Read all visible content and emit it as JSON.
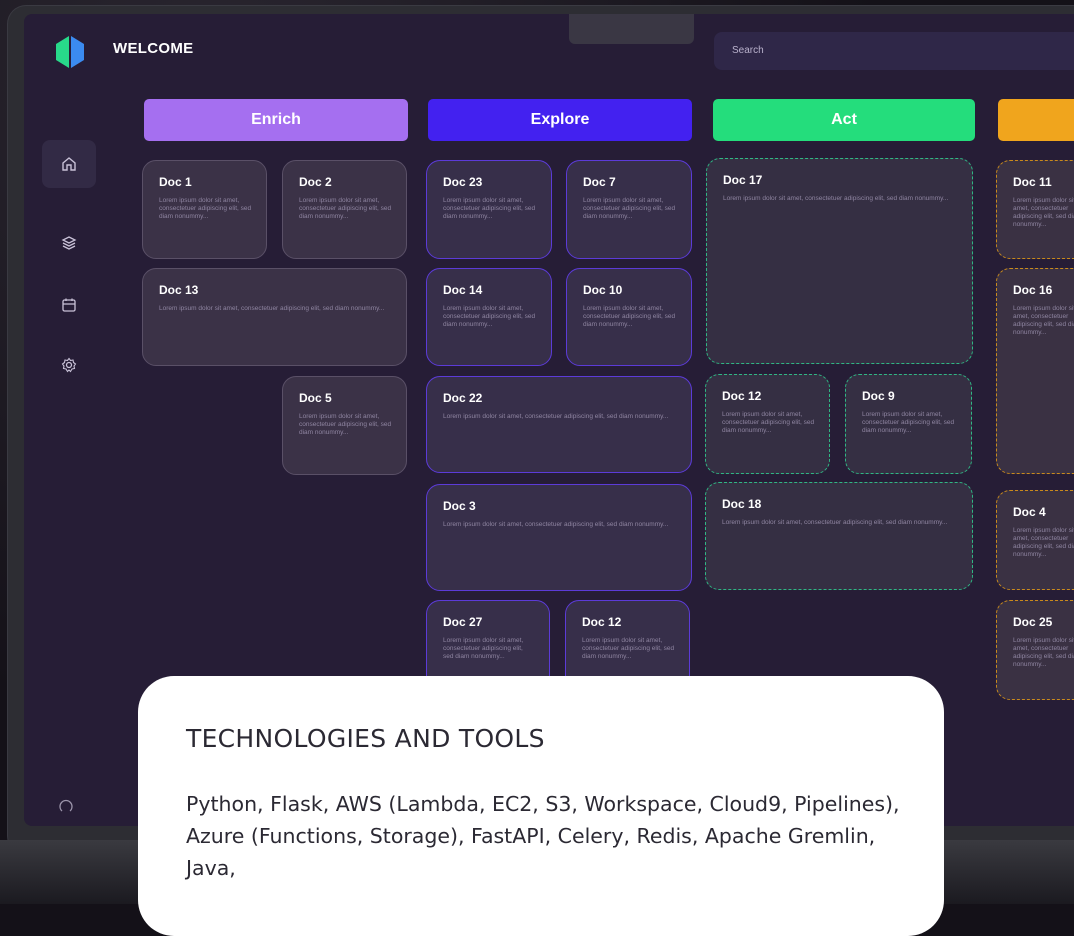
{
  "header": {
    "welcome": "WELCOME",
    "search_placeholder": "Search"
  },
  "sidebar": {
    "items": [
      {
        "icon": "home-icon",
        "active": true
      },
      {
        "icon": "layers-icon",
        "active": false
      },
      {
        "icon": "calendar-icon",
        "active": false
      },
      {
        "icon": "settings-icon",
        "active": false
      }
    ]
  },
  "columns": [
    {
      "label": "Enrich",
      "color": "#a56ff0"
    },
    {
      "label": "Explore",
      "color": "#4321f0"
    },
    {
      "label": "Act",
      "color": "#24dd7c"
    },
    {
      "label": "",
      "color": "#f0a51d"
    }
  ],
  "cards": {
    "doc1": {
      "title": "Doc 1",
      "body": "Lorem ipsum dolor sit amet, consectetuer adipiscing elit, sed diam nonummy..."
    },
    "doc2": {
      "title": "Doc 2",
      "body": "Lorem ipsum dolor sit amet, consectetuer adipiscing elit, sed diam nonummy..."
    },
    "doc13": {
      "title": "Doc 13",
      "body": "Lorem ipsum dolor sit amet, consectetuer adipiscing elit, sed diam nonummy..."
    },
    "doc5": {
      "title": "Doc 5",
      "body": "Lorem ipsum dolor sit amet, consectetuer adipiscing elit, sed diam nonummy..."
    },
    "doc23": {
      "title": "Doc 23",
      "body": "Lorem ipsum dolor sit amet, consectetuer adipiscing elit, sed diam nonummy..."
    },
    "doc7": {
      "title": "Doc 7",
      "body": "Lorem ipsum dolor sit amet, consectetuer adipiscing elit, sed diam nonummy..."
    },
    "doc14": {
      "title": "Doc 14",
      "body": "Lorem ipsum dolor sit amet, consectetuer adipiscing elit, sed diam nonummy..."
    },
    "doc10": {
      "title": "Doc 10",
      "body": "Lorem ipsum dolor sit amet, consectetuer adipiscing elit, sed diam nonummy..."
    },
    "doc22": {
      "title": "Doc 22",
      "body": "Lorem ipsum dolor sit amet, consectetuer adipiscing elit, sed diam nonummy..."
    },
    "doc3": {
      "title": "Doc 3",
      "body": "Lorem ipsum dolor sit amet, consectetuer adipiscing elit, sed diam nonummy..."
    },
    "doc27": {
      "title": "Doc 27",
      "body": "Lorem ipsum dolor sit amet, consectetuer adipiscing elit, sed diam nonummy..."
    },
    "doc12b": {
      "title": "Doc 12",
      "body": "Lorem ipsum dolor sit amet, consectetuer adipiscing elit, sed diam nonummy..."
    },
    "doc17": {
      "title": "Doc 17",
      "body": "Lorem ipsum dolor sit amet, consectetuer adipiscing elit, sed diam nonummy..."
    },
    "doc12": {
      "title": "Doc 12",
      "body": "Lorem ipsum dolor sit amet, consectetuer adipiscing elit, sed diam nonummy..."
    },
    "doc9": {
      "title": "Doc 9",
      "body": "Lorem ipsum dolor sit amet, consectetuer adipiscing elit, sed diam nonummy..."
    },
    "doc18": {
      "title": "Doc 18",
      "body": "Lorem ipsum dolor sit amet, consectetuer adipiscing elit, sed diam nonummy..."
    },
    "doc11": {
      "title": "Doc 11",
      "body": "Lorem ipsum dolor sit amet, consectetuer adipiscing elit, sed diam nonummy..."
    },
    "doc16": {
      "title": "Doc 16",
      "body": "Lorem ipsum dolor sit amet, consectetuer adipiscing elit, sed diam nonummy..."
    },
    "doc4": {
      "title": "Doc 4",
      "body": "Lorem ipsum dolor sit amet, consectetuer adipiscing elit, sed diam nonummy..."
    },
    "doc25": {
      "title": "Doc 25",
      "body": "Lorem ipsum dolor sit amet, consectetuer adipiscing elit, sed diam nonummy..."
    }
  },
  "overlay": {
    "title": "TECHNOLOGIES AND TOOLS",
    "text": "Python, Flask, AWS (Lambda, EC2, S3, Workspace, Cloud9, Pipelines), Azure (Functions, Storage), FastAPI,  Celery, Redis, Apache Gremlin, Java,"
  }
}
